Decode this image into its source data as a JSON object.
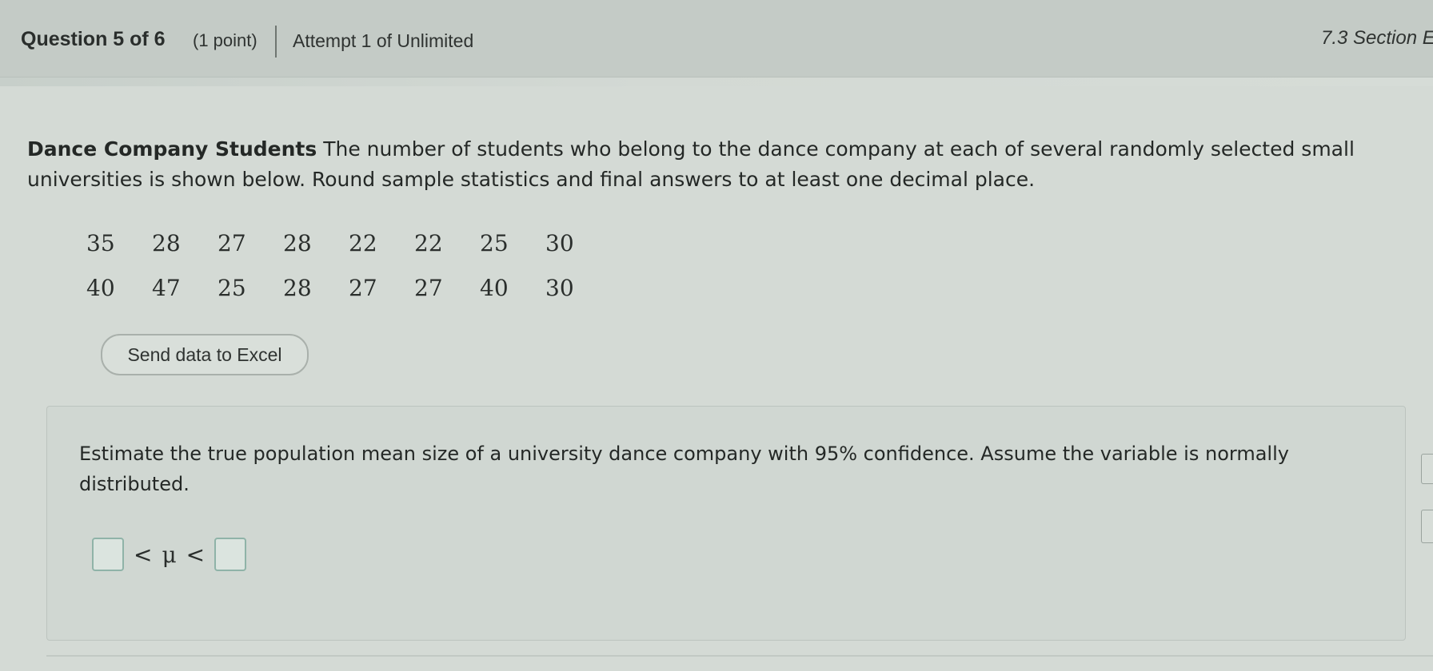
{
  "header": {
    "question_label": "Question 5 of 6",
    "points": "(1 point)",
    "attempt": "Attempt 1 of Unlimited",
    "section": "7.3 Section E"
  },
  "problem": {
    "title": "Dance Company Students",
    "text": "The number of students who belong to the dance company at each of several randomly selected small universities is shown below. Round sample statistics and final answers to at least one decimal place."
  },
  "data_rows": [
    [
      "35",
      "28",
      "27",
      "28",
      "22",
      "22",
      "25",
      "30"
    ],
    [
      "40",
      "47",
      "25",
      "28",
      "27",
      "27",
      "40",
      "30"
    ]
  ],
  "excel_button": "Send data to Excel",
  "answer": {
    "prompt": "Estimate the true population mean size of a university dance company with 95% confidence. Assume the variable is normally distributed.",
    "lower_value": "",
    "upper_value": "",
    "less_than_symbol": "<",
    "mu_symbol": "μ"
  }
}
